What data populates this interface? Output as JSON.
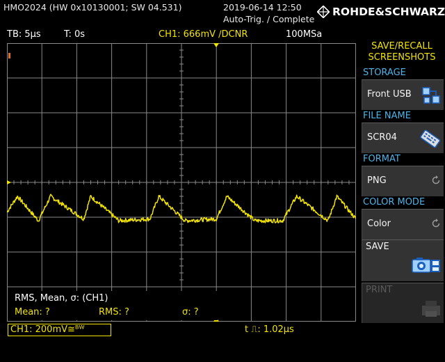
{
  "header": {
    "device": "HMO2024 (HW 0x10130001; SW 04.531)",
    "datetime": "2019-06-14 12:50",
    "trigger_status": "Auto-Trig. / Complete",
    "brand": "ROHDE&SCHWARZ"
  },
  "status_bar": {
    "timebase": "TB: 5µs",
    "trigger_time": "T: 0s",
    "channel_info": "CH1: 666mV ∕DCNR",
    "sample_rate": "100MSa"
  },
  "measurement": {
    "title": "RMS, Mean, σ: (CH1)",
    "mean": "Mean: ?",
    "rms": "RMS: ?",
    "sigma": "σ: ?"
  },
  "bottom_bar": {
    "ch1_scale": "CH1: 200mV≅ᴮᵂ",
    "pulse_width": "t ⎍: 1.02µs"
  },
  "menu": {
    "title_line1": "SAVE/RECALL",
    "title_line2": "SCREENSHOTS",
    "storage_label": "STORAGE",
    "storage_value": "Front USB",
    "file_name_label": "FILE NAME",
    "file_name_value": "SCR04",
    "format_label": "FORMAT",
    "format_value": "PNG",
    "color_mode_label": "COLOR MODE",
    "color_mode_value": "Color",
    "save_label": "SAVE",
    "print_label": "PRINT"
  },
  "colors": {
    "trace": "#f2e400",
    "grid": "#8a8a8a",
    "menu_label": "#4fb3e8",
    "button_bg": "#333333"
  },
  "chart_data": {
    "type": "line",
    "grid": true,
    "divisions_x": 10,
    "divisions_y": 8,
    "series": [
      {
        "x_div": [
          0,
          0.3,
          0.9,
          1.25,
          2.2,
          2.4,
          3.2,
          4.1,
          4.35,
          5.1,
          6.0,
          6.3,
          7.1,
          7.9,
          8.3,
          9.2,
          9.45,
          10
        ],
        "y_div": [
          3.15,
          3.6,
          2.9,
          3.6,
          2.95,
          3.6,
          2.9,
          2.95,
          3.6,
          2.9,
          2.95,
          3.6,
          2.9,
          2.9,
          3.6,
          2.9,
          3.6,
          2.95
        ]
      }
    ]
  }
}
